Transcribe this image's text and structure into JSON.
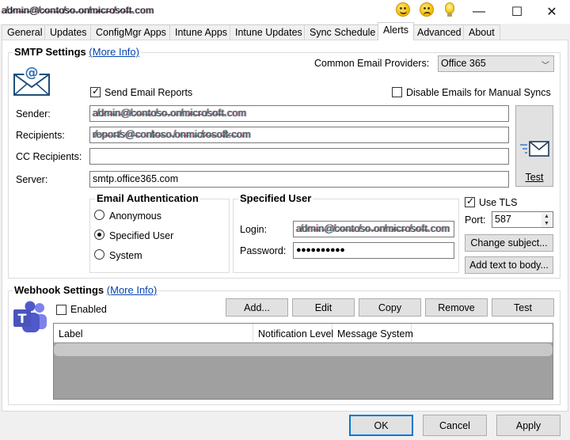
{
  "window": {
    "title": "a̸d̷m̶i̵n̴@̸c̷o̶n̵t̴o̸s̷o̶.̵o̴n̸m̷i̶c̵r̴o̸s̷o̶f̵t̴.com",
    "icons": [
      "smile-emoji-icon",
      "sad-emoji-icon",
      "lightbulb-icon"
    ],
    "controls": {
      "minimize": "—",
      "maximize": "☐",
      "close": "✕"
    }
  },
  "tabs": [
    {
      "label": "General"
    },
    {
      "label": "Updates"
    },
    {
      "label": "ConfigMgr Apps"
    },
    {
      "label": "Intune Apps"
    },
    {
      "label": "Intune Updates"
    },
    {
      "label": "Sync Schedule"
    },
    {
      "label": "Alerts",
      "active": true
    },
    {
      "label": "Advanced"
    },
    {
      "label": "About"
    }
  ],
  "smtp": {
    "title": "SMTP Settings",
    "more_info": "(More Info)",
    "providers_label": "Common Email Providers:",
    "provider_value": "Office 365",
    "send_reports": "Send Email Reports",
    "send_reports_checked": true,
    "disable_manual": "Disable Emails for Manual Syncs",
    "disable_manual_checked": false,
    "sender_label": "Sender:",
    "sender_value": "a̸d̷m̶i̵n̴@̸c̷o̶n̵t̴o̸s̷o̶.̵o̴n̸m̷i̶c̵r̴o̸s̷o̶f̵t̴.com",
    "recipients_label": "Recipients:",
    "recipients_value": "r̸e̷p̶o̵r̴t̸s̷@̶c̵o̴n̸t̷o̶s̵o̴.̸o̷n̶m̵i̴c̸r̷o̶s̵o̴f̸t̷.̶c̵o̴m",
    "cc_label": "CC Recipients:",
    "cc_value": "",
    "server_label": "Server:",
    "server_value": "smtp.office365.com",
    "test_button": "Test"
  },
  "auth": {
    "title": "Email Authentication",
    "options": [
      {
        "label": "Anonymous",
        "selected": false
      },
      {
        "label": "Specified User",
        "selected": true
      },
      {
        "label": "System",
        "selected": false
      }
    ]
  },
  "user": {
    "title": "Specified User",
    "login_label": "Login:",
    "login_value": "a̸d̷m̶i̵n̴@̸c̷o̶n̵t̴o̸s̷o̶.̵o̴n̸m̷i̶c̵r̴o̸s̷o̶f̵t̴.com",
    "password_label": "Password:",
    "password_value": "●●●●●●●●●●"
  },
  "tls": {
    "label": "Use TLS",
    "checked": true,
    "port_label": "Port:",
    "port_value": "587",
    "change_subject": "Change subject...",
    "add_text_body": "Add text to body..."
  },
  "webhook": {
    "title": "Webhook Settings",
    "more_info": "(More Info)",
    "enabled_label": "Enabled",
    "enabled_checked": false,
    "buttons": {
      "add": "Add...",
      "edit": "Edit",
      "copy": "Copy",
      "remove": "Remove",
      "test": "Test"
    },
    "columns": [
      "Label",
      "Notification Level",
      "Message System"
    ]
  },
  "footer": {
    "ok": "OK",
    "cancel": "Cancel",
    "apply": "Apply"
  },
  "colors": {
    "link": "#0645ad",
    "accent": "#0078d7",
    "teams": "#5059c9",
    "email_icon": "#2b6cb0"
  }
}
